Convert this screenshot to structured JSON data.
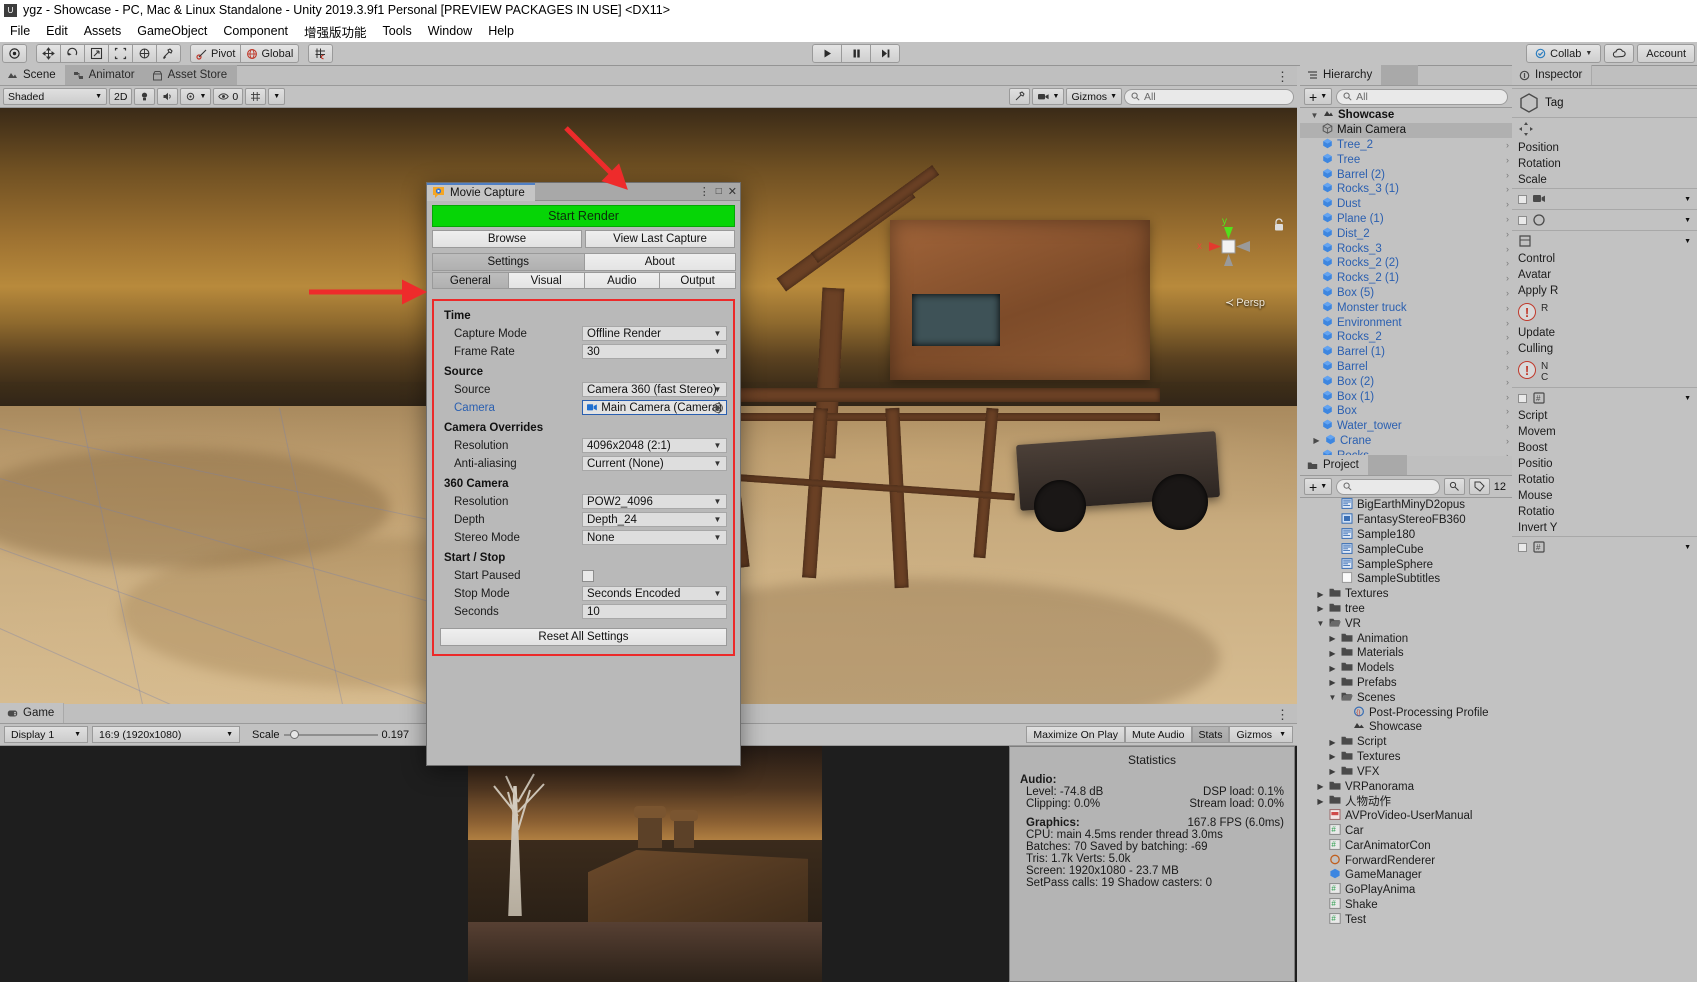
{
  "window": {
    "title": "ygz - Showcase - PC, Mac & Linux Standalone - Unity 2019.3.9f1 Personal [PREVIEW PACKAGES IN USE] <DX11>",
    "icon": "unity-icon"
  },
  "menubar": {
    "items": [
      "File",
      "Edit",
      "Assets",
      "GameObject",
      "Component",
      "增强版功能",
      "Tools",
      "Window",
      "Help"
    ]
  },
  "toolbar": {
    "tools": [
      "hand-tool",
      "move-tool",
      "rotate-tool",
      "scale-tool",
      "rect-tool",
      "transform-tool",
      "custom-tool"
    ],
    "pivot_label": "Pivot",
    "global_label": "Global",
    "snap_label": "grid-snap",
    "play_label": "play-icon",
    "pause_label": "pause-icon",
    "step_label": "step-icon",
    "collab_label": "Collab",
    "cloud_label": "cloud-icon",
    "account_label": "Account"
  },
  "scene": {
    "tabs": [
      {
        "label": "Scene",
        "icon": "scene-icon",
        "selected": true
      },
      {
        "label": "Animator",
        "icon": "animator-icon",
        "selected": false
      },
      {
        "label": "Asset Store",
        "icon": "store-icon",
        "selected": false
      }
    ],
    "shading_mode": "Shaded",
    "mode_2d": "2D",
    "light_icon": "light-icon",
    "audio_icon": "audio-icon",
    "fx_label": "fx-dropdown",
    "visibility_count": "0",
    "grid_icon": "grid-icon",
    "gizmos_label": "Gizmos",
    "search_placeholder": "All",
    "search_value": "",
    "axis_labels": {
      "x": "x",
      "y": "y"
    },
    "projection": "Persp",
    "more_menu": "⋮"
  },
  "game": {
    "tab_label": "Game",
    "display": "Display 1",
    "aspect": "16:9 (1920x1080)",
    "scale_label": "Scale",
    "scale_value": "0.197",
    "maximize_on_play": "Maximize On Play",
    "mute_audio": "Mute Audio",
    "stats": "Stats",
    "gizmos": "Gizmos"
  },
  "statistics": {
    "title": "Statistics",
    "audio_header": "Audio:",
    "audio_rows": [
      {
        "left": "Level: -74.8 dB",
        "right": "DSP load: 0.1%"
      },
      {
        "left": "Clipping: 0.0%",
        "right": "Stream load: 0.0%"
      }
    ],
    "graphics_header": "Graphics:",
    "fps": "167.8 FPS (6.0ms)",
    "graphics_rows": [
      "CPU: main 4.5ms  render thread 3.0ms",
      "Batches: 70      Saved by batching: -69",
      "Tris: 1.7k        Verts: 5.0k",
      "Screen: 1920x1080 - 23.7 MB",
      "SetPass calls: 19        Shadow casters: 0"
    ]
  },
  "hierarchy": {
    "tab_label": "Hierarchy",
    "add_label": "+",
    "search_placeholder": "All",
    "root": "Showcase",
    "items": [
      {
        "label": "Main Camera",
        "icon": "gameobject-icon",
        "selected": true,
        "color": "dark",
        "expandable": false
      },
      {
        "label": "Tree_2",
        "icon": "prefab-icon",
        "color": "blue",
        "expandable": true
      },
      {
        "label": "Tree",
        "icon": "prefab-icon",
        "color": "blue",
        "expandable": true
      },
      {
        "label": "Barrel (2)",
        "icon": "prefab-icon",
        "color": "blue",
        "expandable": true
      },
      {
        "label": "Rocks_3 (1)",
        "icon": "prefab-icon",
        "color": "blue",
        "expandable": true
      },
      {
        "label": "Dust",
        "icon": "prefab-icon",
        "color": "blue",
        "expandable": true
      },
      {
        "label": "Plane (1)",
        "icon": "prefab-icon",
        "color": "blue",
        "expandable": true
      },
      {
        "label": "Dist_2",
        "icon": "prefab-icon",
        "color": "blue",
        "expandable": true
      },
      {
        "label": "Rocks_3",
        "icon": "prefab-icon",
        "color": "blue",
        "expandable": true
      },
      {
        "label": "Rocks_2 (2)",
        "icon": "prefab-icon",
        "color": "blue",
        "expandable": true
      },
      {
        "label": "Rocks_2 (1)",
        "icon": "prefab-icon",
        "color": "blue",
        "expandable": true
      },
      {
        "label": "Box (5)",
        "icon": "prefab-icon",
        "color": "blue",
        "expandable": true
      },
      {
        "label": "Monster truck",
        "icon": "prefab-icon",
        "color": "blue",
        "expandable": true
      },
      {
        "label": "Environment",
        "icon": "prefab-icon",
        "color": "blue",
        "expandable": true
      },
      {
        "label": "Rocks_2",
        "icon": "prefab-icon",
        "color": "blue",
        "expandable": true
      },
      {
        "label": "Barrel (1)",
        "icon": "prefab-icon",
        "color": "blue",
        "expandable": true
      },
      {
        "label": "Barrel",
        "icon": "prefab-icon",
        "color": "blue",
        "expandable": true
      },
      {
        "label": "Box (2)",
        "icon": "prefab-icon",
        "color": "blue",
        "expandable": true
      },
      {
        "label": "Box (1)",
        "icon": "prefab-icon",
        "color": "blue",
        "expandable": true
      },
      {
        "label": "Box",
        "icon": "prefab-icon",
        "color": "blue",
        "expandable": true
      },
      {
        "label": "Water_tower",
        "icon": "prefab-icon",
        "color": "blue",
        "expandable": true
      },
      {
        "label": "Crane",
        "icon": "prefab-icon",
        "color": "blue",
        "expandable": true,
        "has_left_arrow": true
      },
      {
        "label": "Rocks",
        "icon": "prefab-icon",
        "color": "blue",
        "expandable": true
      }
    ]
  },
  "project": {
    "tab_label": "Project",
    "add_label": "+",
    "search_placeholder": "",
    "count_badge": "12",
    "items": [
      {
        "label": "BigEarthMinyD2opus",
        "icon": "script-icon",
        "indent": 3,
        "arrow": "",
        "clipped": true
      },
      {
        "label": "FantasyStereoFB360",
        "icon": "material-icon",
        "indent": 3,
        "arrow": ""
      },
      {
        "label": "Sample180",
        "icon": "script-icon",
        "indent": 3,
        "arrow": ""
      },
      {
        "label": "SampleCube",
        "icon": "script-icon",
        "indent": 3,
        "arrow": ""
      },
      {
        "label": "SampleSphere",
        "icon": "script-icon",
        "indent": 3,
        "arrow": ""
      },
      {
        "label": "SampleSubtitles",
        "icon": "text-icon",
        "indent": 3,
        "arrow": ""
      },
      {
        "label": "Textures",
        "icon": "folder-icon",
        "indent": 2,
        "arrow": "▶"
      },
      {
        "label": "tree",
        "icon": "folder-icon",
        "indent": 2,
        "arrow": "▶"
      },
      {
        "label": "VR",
        "icon": "folder-open-icon",
        "indent": 2,
        "arrow": "▼"
      },
      {
        "label": "Animation",
        "icon": "folder-icon",
        "indent": 3,
        "arrow": "▶"
      },
      {
        "label": "Materials",
        "icon": "folder-icon",
        "indent": 3,
        "arrow": "▶"
      },
      {
        "label": "Models",
        "icon": "folder-icon",
        "indent": 3,
        "arrow": "▶"
      },
      {
        "label": "Prefabs",
        "icon": "folder-icon",
        "indent": 3,
        "arrow": "▶"
      },
      {
        "label": "Scenes",
        "icon": "folder-open-icon",
        "indent": 3,
        "arrow": "▼"
      },
      {
        "label": "Post-Processing Profile",
        "icon": "profile-icon",
        "indent": 4,
        "arrow": ""
      },
      {
        "label": "Showcase",
        "icon": "scene-asset-icon",
        "indent": 4,
        "arrow": ""
      },
      {
        "label": "Script",
        "icon": "folder-icon",
        "indent": 3,
        "arrow": "▶"
      },
      {
        "label": "Textures",
        "icon": "folder-icon",
        "indent": 3,
        "arrow": "▶"
      },
      {
        "label": "VFX",
        "icon": "folder-icon",
        "indent": 3,
        "arrow": "▶"
      },
      {
        "label": "VRPanorama",
        "icon": "folder-icon",
        "indent": 2,
        "arrow": "▶"
      },
      {
        "label": "人物动作",
        "icon": "folder-icon",
        "indent": 2,
        "arrow": "▶"
      },
      {
        "label": "AVProVideo-UserManual",
        "icon": "pdf-icon",
        "indent": 2,
        "arrow": ""
      },
      {
        "label": "Car",
        "icon": "cs-script-icon",
        "indent": 2,
        "arrow": ""
      },
      {
        "label": "CarAnimatorCon",
        "icon": "cs-script-icon",
        "indent": 2,
        "arrow": ""
      },
      {
        "label": "ForwardRenderer",
        "icon": "asset-icon",
        "indent": 2,
        "arrow": ""
      },
      {
        "label": "GameManager",
        "icon": "prefab-asset-icon",
        "indent": 2,
        "arrow": ""
      },
      {
        "label": "GoPlayAnima",
        "icon": "cs-script-icon",
        "indent": 2,
        "arrow": ""
      },
      {
        "label": "Shake",
        "icon": "cs-script-icon",
        "indent": 2,
        "arrow": ""
      },
      {
        "label": "Test",
        "icon": "cs-script-icon",
        "indent": 2,
        "arrow": ""
      }
    ]
  },
  "inspector": {
    "tab_label": "Inspector",
    "tag_label": "Tag",
    "transform_rows": [
      "Position",
      "Rotation",
      "Scale"
    ],
    "component_rows": [
      "Control",
      "Avatar",
      "Apply R"
    ],
    "extra_rows": [
      "Update",
      "Culling"
    ],
    "script_label": "Script",
    "script_fields": [
      "Movem",
      "Boost",
      "Positio",
      "Rotatio",
      "Mouse",
      "Rotatio",
      "Invert Y"
    ]
  },
  "movie_capture": {
    "window_title": "Movie Capture",
    "window_icon": "movie-capture-icon",
    "win_buttons": [
      "⋮",
      "□",
      "✕"
    ],
    "start_render": "Start Render",
    "browse": "Browse",
    "view_last_capture": "View Last Capture",
    "primary_tabs": [
      {
        "label": "Settings",
        "selected": true
      },
      {
        "label": "About",
        "selected": false
      }
    ],
    "secondary_tabs": [
      {
        "label": "General",
        "selected": true
      },
      {
        "label": "Visual",
        "selected": false
      },
      {
        "label": "Audio",
        "selected": false
      },
      {
        "label": "Output",
        "selected": false
      }
    ],
    "groups": [
      {
        "title": "Time",
        "fields": [
          {
            "label": "Capture Mode",
            "value": "Offline Render",
            "type": "dropdown"
          },
          {
            "label": "Frame Rate",
            "value": "30",
            "type": "dropdown"
          }
        ]
      },
      {
        "title": "Source",
        "fields": [
          {
            "label": "Source",
            "value": "Camera 360 (fast Stereo)",
            "type": "dropdown"
          },
          {
            "label": "Camera",
            "value": "Main Camera (Camera)",
            "type": "object",
            "label_link": true,
            "icon": "camera-icon"
          }
        ]
      },
      {
        "title": "Camera Overrides",
        "fields": [
          {
            "label": "Resolution",
            "value": "4096x2048 (2:1)",
            "type": "dropdown"
          },
          {
            "label": "Anti-aliasing",
            "value": "Current (None)",
            "type": "dropdown"
          }
        ]
      },
      {
        "title": "360 Camera",
        "fields": [
          {
            "label": "Resolution",
            "value": "POW2_4096",
            "type": "dropdown"
          },
          {
            "label": "Depth",
            "value": "Depth_24",
            "type": "dropdown"
          },
          {
            "label": "Stereo Mode",
            "value": "None",
            "type": "dropdown"
          }
        ]
      },
      {
        "title": "Start / Stop",
        "fields": [
          {
            "label": "Start Paused",
            "value": "",
            "type": "checkbox",
            "checked": false
          },
          {
            "label": "Stop Mode",
            "value": "Seconds Encoded",
            "type": "dropdown"
          },
          {
            "label": "Seconds",
            "value": "10",
            "type": "text"
          }
        ]
      }
    ],
    "reset_all": "Reset All Settings"
  },
  "colors": {
    "accent_green": "#06d506",
    "annotation_red": "#ec2a2a",
    "link_blue": "#2a5fb0",
    "panel_gray": "#c2c2c2"
  }
}
